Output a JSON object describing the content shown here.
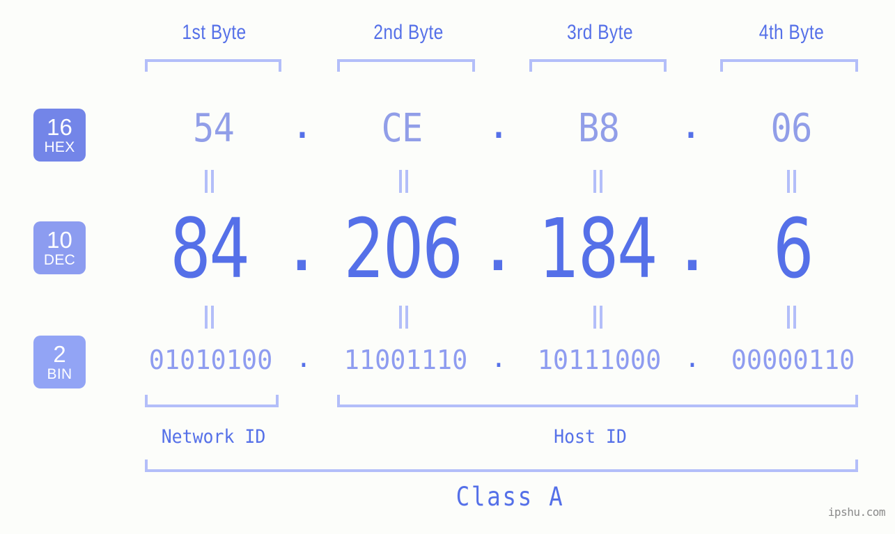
{
  "header": {
    "byte_labels": [
      "1st Byte",
      "2nd Byte",
      "3rd Byte",
      "4th Byte"
    ]
  },
  "radix_badges": [
    {
      "base": "16",
      "system": "HEX",
      "color": "#7385e8"
    },
    {
      "base": "10",
      "system": "DEC",
      "color": "#8c9cf0"
    },
    {
      "base": "2",
      "system": "BIN",
      "color": "#92a4f5"
    }
  ],
  "rows": {
    "hex": {
      "values": [
        "54",
        "CE",
        "B8",
        "06"
      ],
      "separator": "."
    },
    "dec": {
      "values": [
        "84",
        "206",
        "184",
        "6"
      ],
      "separator": "."
    },
    "bin": {
      "values": [
        "01010100",
        "11001110",
        "10111000",
        "00000110"
      ],
      "separator": "."
    }
  },
  "equals_marker": "=",
  "segments": {
    "network_id": "Network ID",
    "host_id": "Host ID"
  },
  "class_label": "Class A",
  "watermark": "ipshu.com",
  "colors": {
    "background": "#fcfdfa",
    "accent_strong": "#5570e8",
    "accent_light": "#919ee8",
    "bracket": "#b3bef9",
    "watermark": "#8a8a8a"
  }
}
